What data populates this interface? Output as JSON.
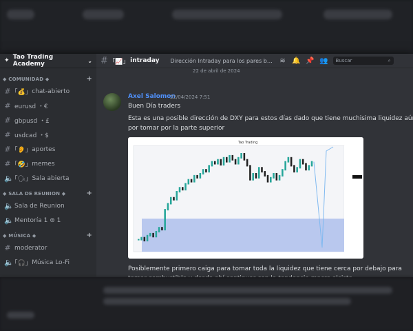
{
  "server": {
    "name": "Tao Trading Academy"
  },
  "categories": [
    {
      "label": "COMUNIDAD",
      "channels": [
        {
          "label": "chat-abierto",
          "icon": "money-bag-emoji-icon"
        },
        {
          "label": "eurusd ・€",
          "icon": "hash-icon"
        },
        {
          "label": "gbpusd ・£",
          "icon": "hash-icon"
        },
        {
          "label": "usdcad ・$",
          "icon": "hash-icon"
        },
        {
          "label": "aportes",
          "icon": "ear-emoji-icon"
        },
        {
          "label": "memes",
          "icon": "laughing-emoji-icon"
        },
        {
          "label": "Sala abierta",
          "icon": "speaker-icon"
        }
      ]
    },
    {
      "label": "SALA DE REUNION",
      "channels": [
        {
          "label": "Sala de Reunion",
          "icon": "speaker-icon"
        },
        {
          "label": "Mentoría 1 ⊜ 1",
          "icon": "speaker-icon"
        }
      ]
    },
    {
      "label": "MÚSICA",
      "channels": [
        {
          "label": "moderator",
          "icon": "hash-icon"
        },
        {
          "label": "Música Lo-Fi",
          "icon": "headphones-icon"
        }
      ]
    }
  ],
  "channel": {
    "name": "intraday",
    "topic": "Dirección Intraday para los pares bi..."
  },
  "search": {
    "placeholder": "Buscar"
  },
  "date_divider": "22 de abril de 2024",
  "message": {
    "author": "Axel Salomon",
    "timestamp": "22/04/2024 7:51",
    "line1": "Buen Día traders",
    "line2": "Esta es una posible dirección de DXY para estos días dado que tiene muchisima liquidez aún por tomar por la parte superior",
    "line3": "Posiblemente primero caiga para tomar toda la liquidez que tiene cerca por debajo para tomar combustible y desde ahí continuar con la tendencia macro alcista"
  },
  "chart_data": {
    "type": "line",
    "title": "Tao Trading",
    "series": [
      {
        "values": [
          10,
          12,
          9,
          14,
          16,
          13,
          18,
          22,
          20,
          40,
          46,
          52,
          50,
          58,
          62,
          60,
          66,
          70,
          68,
          74,
          72,
          76,
          80,
          78,
          84,
          88,
          86,
          90,
          85,
          92,
          88,
          94,
          90,
          86,
          92,
          96,
          90,
          84,
          70,
          76,
          72,
          82,
          78,
          74,
          68,
          72,
          76,
          70,
          74,
          80,
          88,
          92,
          84,
          78,
          82,
          90,
          86,
          80,
          84,
          88
        ]
      }
    ],
    "colors": {
      "bull": "#26a69a",
      "bear": "#222222",
      "zone": "#b9c8ee",
      "projection": "#7fb9f0"
    }
  }
}
